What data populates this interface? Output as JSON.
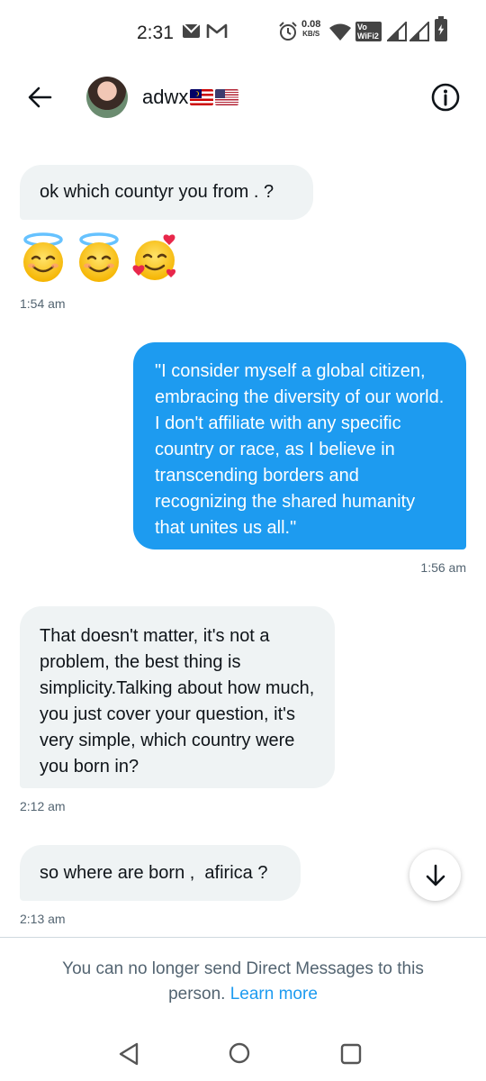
{
  "status_bar": {
    "time": "2:31",
    "speed_value": "0.08",
    "speed_unit": "KB/S",
    "volte_top": "Vo",
    "volte_bottom": "WiFi2",
    "icons": [
      "mail-icon",
      "gmail-icon",
      "alarm-icon",
      "wifi-icon",
      "volte-icon",
      "signal-icon",
      "signal-icon",
      "battery-charging-icon"
    ]
  },
  "header": {
    "contact_name": "adwx",
    "flags": [
      "malaysia-flag-icon",
      "us-flag-icon"
    ],
    "icons": [
      "back-arrow-icon",
      "info-icon"
    ]
  },
  "messages": [
    {
      "direction": "incoming",
      "text": "ok which countyr you from . ?"
    },
    {
      "direction": "incoming",
      "emojis": [
        "😇",
        "😇",
        "🥰"
      ],
      "timestamp": "1:54 am"
    },
    {
      "direction": "outgoing",
      "text": "\"I consider myself a global citizen, embracing the diversity of our world. I don't affiliate with any specific country or race, as I believe in transcending borders and recognizing the shared humanity that unites us all.\"",
      "timestamp": "1:56 am"
    },
    {
      "direction": "incoming",
      "text": "That doesn't matter, it's not a problem, the best thing is simplicity.Talking about how much, you just cover your question, it's very simple, which country were you born in?",
      "timestamp": "2:12 am"
    },
    {
      "direction": "incoming",
      "text": "so where are born ,  afirica ?",
      "timestamp": "2:13 am"
    }
  ],
  "notice": {
    "text": "You can no longer send Direct Messages to this person.",
    "link": "Learn more"
  },
  "colors": {
    "accent": "#1d9bf0",
    "incoming_bubble": "#eff3f4",
    "timestamp": "#536471"
  },
  "nav_bar": {
    "icons": [
      "nav-back-icon",
      "nav-home-icon",
      "nav-recents-icon"
    ]
  }
}
